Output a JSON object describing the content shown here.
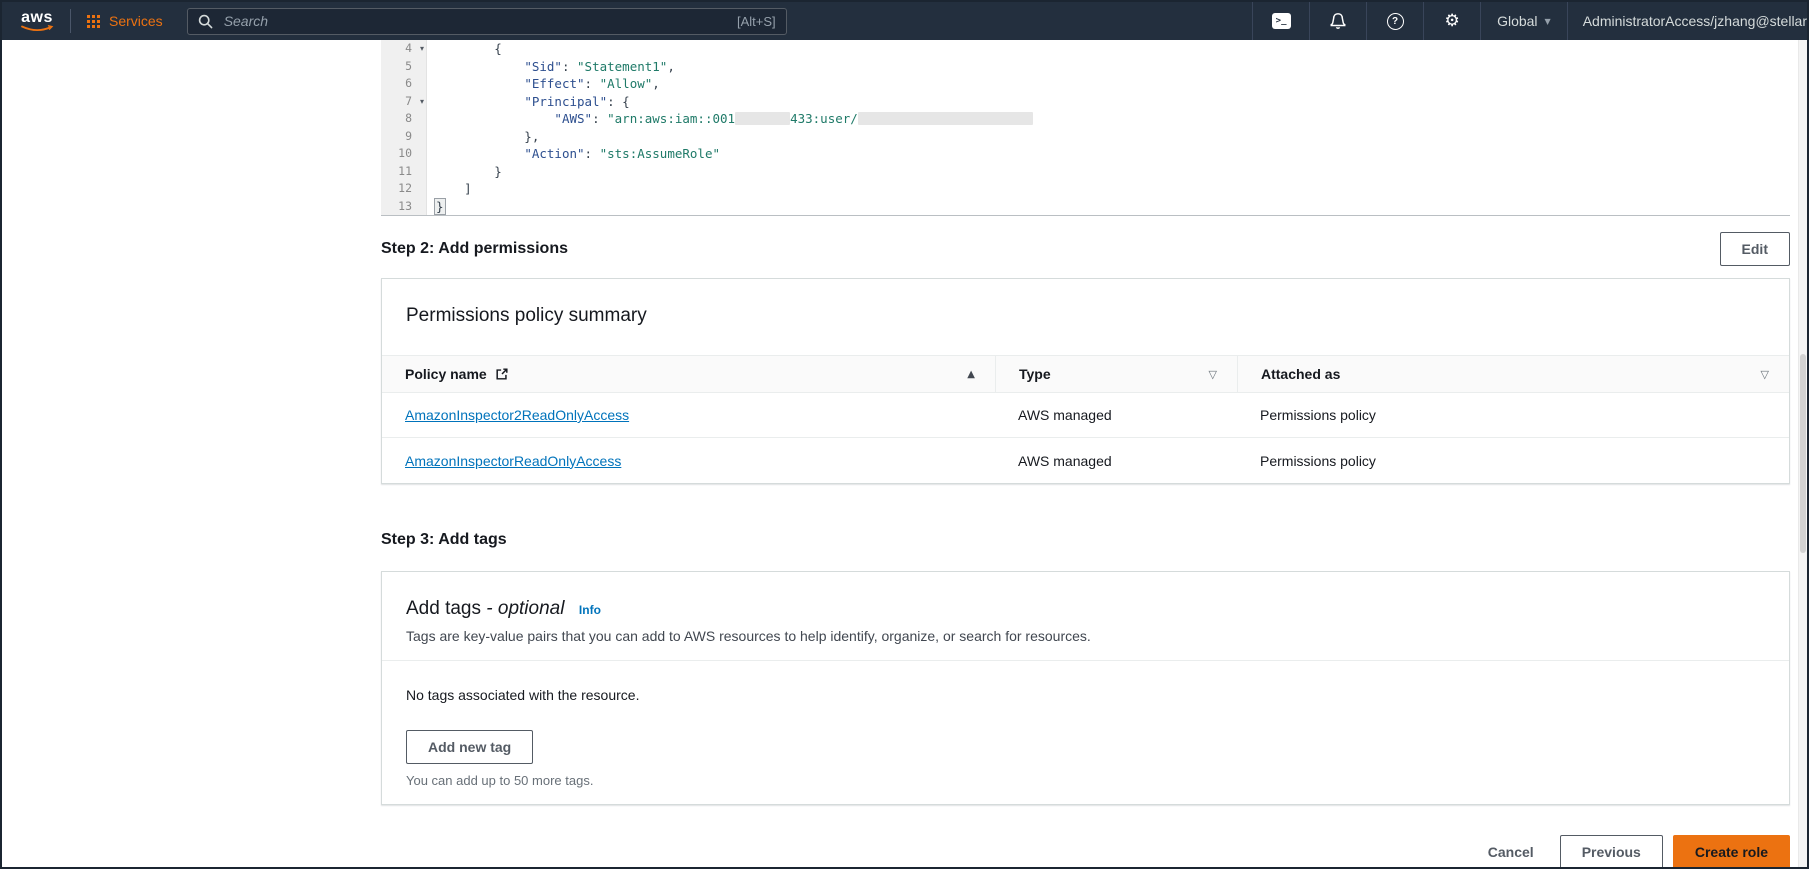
{
  "topbar": {
    "logo_text": "aws",
    "services_label": "Services",
    "search_placeholder": "Search",
    "search_shortcut": "[Alt+S]",
    "region_label": "Global",
    "account_label": "AdministratorAccess/jzhang@stellar"
  },
  "icons": {
    "cloudshell": ">_",
    "help": "?",
    "gear": "⚙",
    "dropdown": "▼",
    "fold": "▾",
    "sort_ascending": "▲",
    "filter": "▽"
  },
  "colors": {
    "topbar_bg": "#232f3e",
    "accent_orange": "#ec7211",
    "link_blue": "#0073bb",
    "text_dark": "#16191f"
  },
  "editor": {
    "lines": [
      {
        "num": "4",
        "fold": true,
        "parts": [
          {
            "type": "plain",
            "text": "        {"
          }
        ]
      },
      {
        "num": "5",
        "parts": [
          {
            "type": "plain",
            "text": "            "
          },
          {
            "type": "key",
            "text": "\"Sid\""
          },
          {
            "type": "plain",
            "text": ": "
          },
          {
            "type": "str",
            "text": "\"Statement1\""
          },
          {
            "type": "plain",
            "text": ","
          }
        ]
      },
      {
        "num": "6",
        "parts": [
          {
            "type": "plain",
            "text": "            "
          },
          {
            "type": "key",
            "text": "\"Effect\""
          },
          {
            "type": "plain",
            "text": ": "
          },
          {
            "type": "str",
            "text": "\"Allow\""
          },
          {
            "type": "plain",
            "text": ","
          }
        ]
      },
      {
        "num": "7",
        "fold": true,
        "parts": [
          {
            "type": "plain",
            "text": "            "
          },
          {
            "type": "key",
            "text": "\"Principal\""
          },
          {
            "type": "plain",
            "text": ": {"
          }
        ]
      },
      {
        "num": "8",
        "parts": [
          {
            "type": "plain",
            "text": "                "
          },
          {
            "type": "key",
            "text": "\"AWS\""
          },
          {
            "type": "plain",
            "text": ": "
          },
          {
            "type": "str",
            "text": "\"arn:aws:iam::001"
          },
          {
            "type": "redact",
            "w": 55
          },
          {
            "type": "str",
            "text": "433:user/"
          },
          {
            "type": "redact",
            "w": 175
          }
        ]
      },
      {
        "num": "9",
        "parts": [
          {
            "type": "plain",
            "text": "            },"
          }
        ]
      },
      {
        "num": "10",
        "parts": [
          {
            "type": "plain",
            "text": "            "
          },
          {
            "type": "key",
            "text": "\"Action\""
          },
          {
            "type": "plain",
            "text": ": "
          },
          {
            "type": "str",
            "text": "\"sts:AssumeRole\""
          }
        ]
      },
      {
        "num": "11",
        "parts": [
          {
            "type": "plain",
            "text": "        }"
          }
        ]
      },
      {
        "num": "12",
        "parts": [
          {
            "type": "plain",
            "text": "    ]"
          }
        ]
      },
      {
        "num": "13",
        "parts": [
          {
            "type": "hl",
            "text": "}"
          }
        ]
      }
    ]
  },
  "step2": {
    "heading": "Step 2: Add permissions",
    "edit_button": "Edit"
  },
  "permissions_table": {
    "card_title": "Permissions policy summary",
    "col_policy": "Policy name",
    "col_type": "Type",
    "col_attached": "Attached as",
    "rows": [
      {
        "name": "AmazonInspector2ReadOnlyAccess",
        "type": "AWS managed",
        "attached": "Permissions policy"
      },
      {
        "name": "AmazonInspectorReadOnlyAccess",
        "type": "AWS managed",
        "attached": "Permissions policy"
      }
    ]
  },
  "step3": {
    "heading": "Step 3: Add tags"
  },
  "tags_card": {
    "title": "Add tags ",
    "title_optional": "- optional",
    "info_link": "Info",
    "description": "Tags are key-value pairs that you can add to AWS resources to help identify, organize, or search for resources.",
    "empty_message": "No tags associated with the resource.",
    "add_tag_button": "Add new tag",
    "limit_note": "You can add up to 50 more tags."
  },
  "footer": {
    "cancel_button": "Cancel",
    "previous_button": "Previous",
    "create_button": "Create role"
  }
}
